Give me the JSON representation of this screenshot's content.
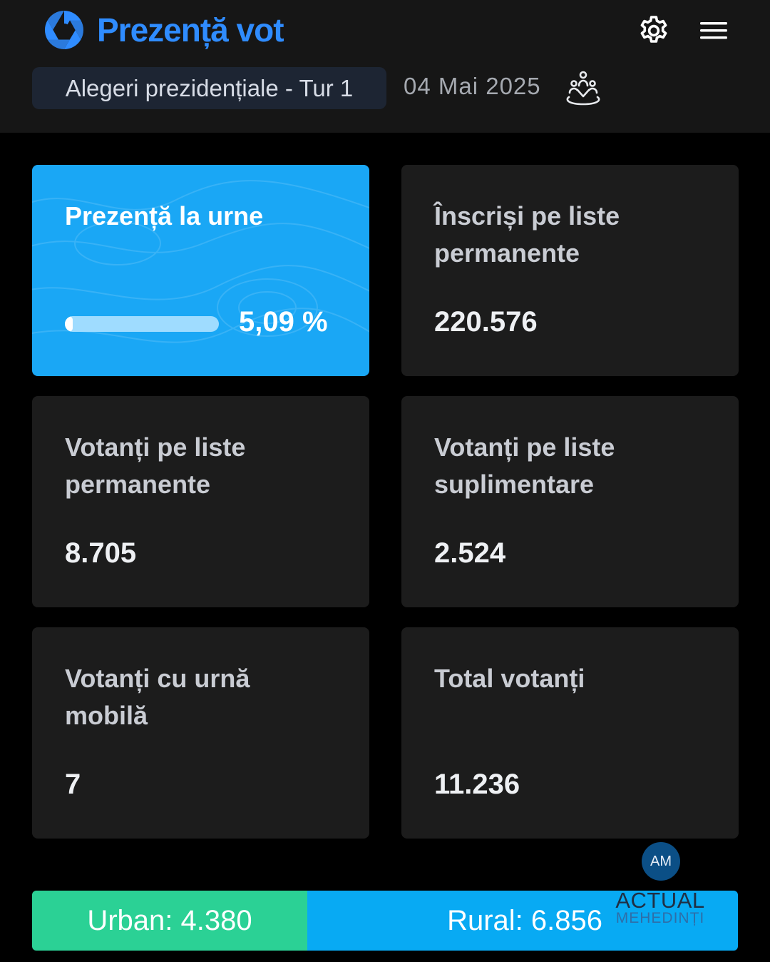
{
  "header": {
    "app_title": "Prezență vot",
    "election_label": "Alegeri prezidențiale - Tur 1",
    "election_date": "04 Mai 2025",
    "icons": {
      "logo": "aperture-logo-icon",
      "settings": "gear-icon",
      "menu": "hamburger-menu-icon",
      "map": "map-pin-people-icon"
    }
  },
  "cards": {
    "turnout": {
      "label": "Prezență la urne",
      "value_text": "5,09 %",
      "percent": 5.09
    },
    "registered_permanent": {
      "label": "Înscriși pe liste permanente",
      "value": "220.576"
    },
    "voters_permanent": {
      "label": "Votanți pe liste permanente",
      "value": "8.705"
    },
    "voters_supplementary": {
      "label": "Votanți pe liste suplimentare",
      "value": "2.524"
    },
    "voters_mobile": {
      "label": "Votanți cu urnă mobilă",
      "value": "7"
    },
    "total_voters": {
      "label": "Total votanți",
      "value": "11.236"
    }
  },
  "split": {
    "urban_label": "Urban: 4.380",
    "urban_count": 4380,
    "rural_label": "Rural: 6.856",
    "rural_count": 6856
  },
  "watermark": {
    "badge": "AM",
    "line1": "ACTUAL",
    "line2": "MEHEDINȚI"
  },
  "colors": {
    "brand": "#2f8cff",
    "turnout_card": "#1aa7f5",
    "urban": "#2bd195",
    "rural": "#08aaf3",
    "card": "#1c1c1c",
    "header": "#161616"
  }
}
